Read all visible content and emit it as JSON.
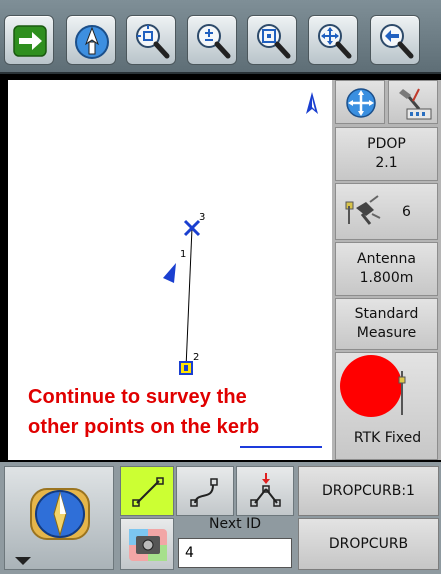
{
  "toolbar": {
    "buttons": [
      {
        "name": "next-arrow",
        "icon": "arrow-right-icon"
      },
      {
        "name": "north-up",
        "icon": "north-arrow-icon"
      },
      {
        "name": "zoom-center",
        "icon": "zoom-center-icon"
      },
      {
        "name": "zoom-in-out",
        "icon": "zoom-plus-minus-icon"
      },
      {
        "name": "zoom-extents",
        "icon": "zoom-extents-icon"
      },
      {
        "name": "pan",
        "icon": "pan-icon"
      },
      {
        "name": "back",
        "icon": "back-arrow-icon"
      }
    ]
  },
  "map": {
    "points": [
      {
        "label": "1",
        "marker": "line-vertex"
      },
      {
        "label": "2",
        "marker": "yellow-square"
      },
      {
        "label": "3",
        "marker": "blue-cross"
      }
    ],
    "instruction_line1": "Continue to survey the",
    "instruction_line2": "other points on the kerb",
    "north_indicator": "north-arrow-icon"
  },
  "status": {
    "pdop_label": "PDOP",
    "pdop_value": "2.1",
    "satellites": "6",
    "antenna_label": "Antenna",
    "antenna_height": "1.800m",
    "measure_line1": "Standard",
    "measure_line2": "Measure",
    "fix_status": "RTK Fixed",
    "fix_color": "#ff0000"
  },
  "bottom": {
    "next_id_label": "Next ID",
    "next_id_value": "4",
    "code_primary": "DROPCURB:1",
    "code_secondary": "DROPCURB",
    "line_mode_active_color": "#ccff33"
  }
}
